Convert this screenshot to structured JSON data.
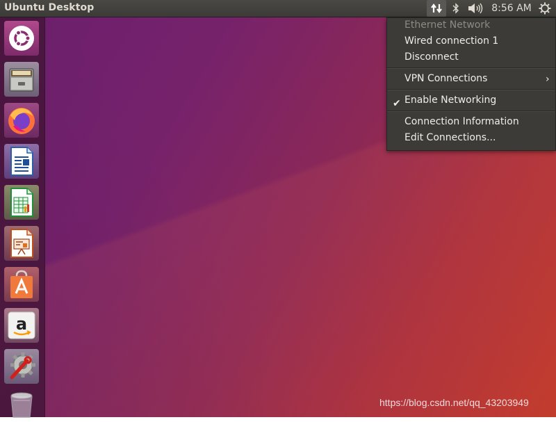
{
  "top_panel": {
    "window_title": "Ubuntu Desktop",
    "clock": "8:56 AM"
  },
  "launcher": {
    "items": [
      {
        "name": "ubuntu-dash",
        "icon": "ubuntu-logo-icon"
      },
      {
        "name": "files",
        "icon": "file-cabinet-icon"
      },
      {
        "name": "firefox",
        "icon": "firefox-icon"
      },
      {
        "name": "libreoffice-writer",
        "icon": "writer-icon"
      },
      {
        "name": "libreoffice-calc",
        "icon": "calc-icon"
      },
      {
        "name": "libreoffice-impress",
        "icon": "impress-icon"
      },
      {
        "name": "ubuntu-software",
        "icon": "software-bag-icon"
      },
      {
        "name": "amazon",
        "icon": "amazon-icon"
      },
      {
        "name": "system-settings",
        "icon": "settings-wrench-icon"
      },
      {
        "name": "trash",
        "icon": "trash-icon"
      }
    ]
  },
  "network_menu": {
    "header": "Ethernet Network",
    "wired_connection": "Wired connection 1",
    "disconnect": "Disconnect",
    "vpn_connections": "VPN Connections",
    "enable_networking": "Enable Networking",
    "connection_information": "Connection Information",
    "edit_connections": "Edit Connections..."
  },
  "watermark": "https://blog.csdn.net/qq_43203949",
  "colors": {
    "panel": "#3c3b37",
    "menu_bg": "#3c3b37",
    "launcher": "#46163a",
    "wallpaper_start": "#6a1f6e",
    "wallpaper_end": "#c0392b"
  }
}
